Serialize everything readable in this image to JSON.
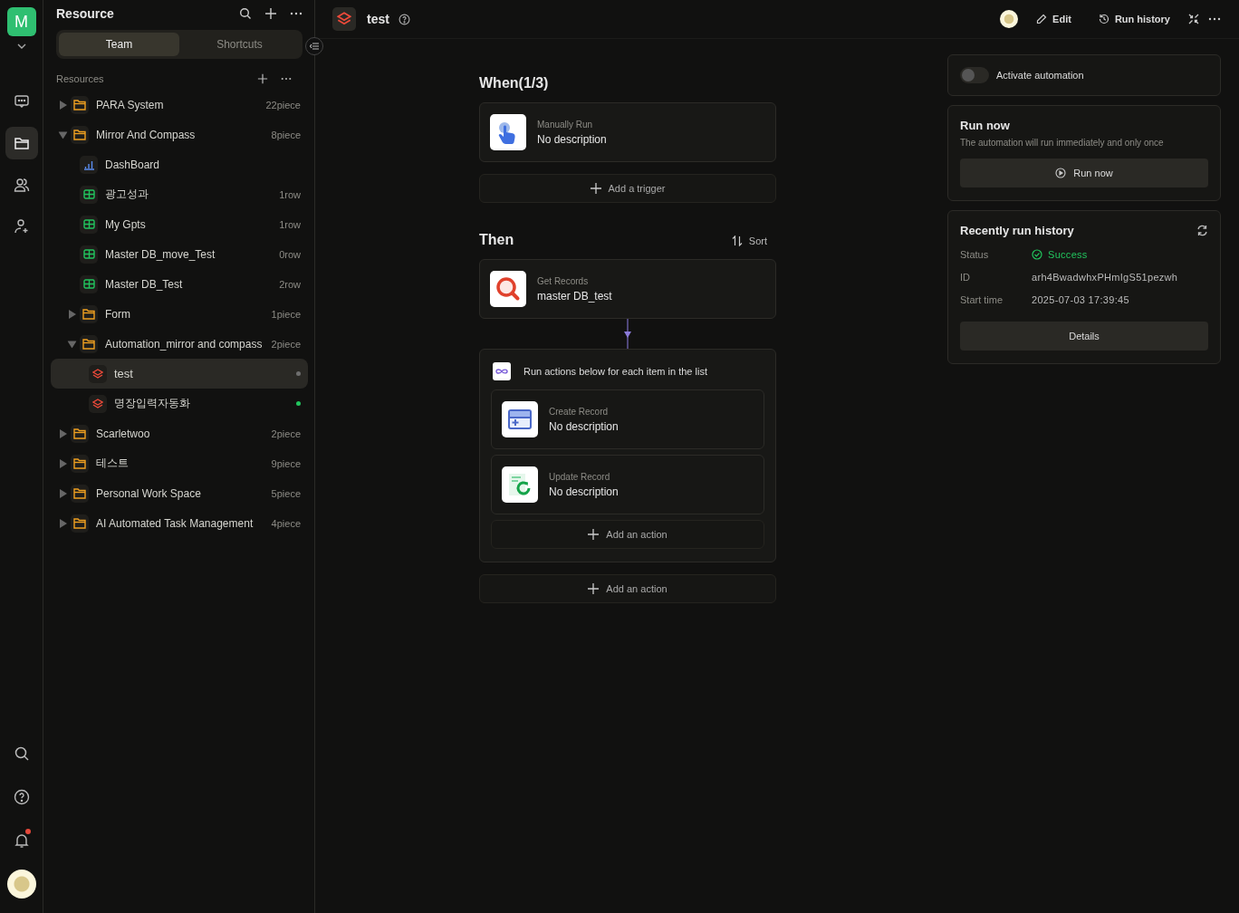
{
  "rail": {
    "workspace_initial": "M",
    "nav": [
      {
        "kind": "chat",
        "selected": false
      },
      {
        "kind": "folder",
        "selected": true
      },
      {
        "kind": "people",
        "selected": false
      },
      {
        "kind": "person-add",
        "selected": false
      }
    ],
    "bottom": [
      {
        "kind": "search",
        "badge": false
      },
      {
        "kind": "help",
        "badge": false
      },
      {
        "kind": "bell",
        "badge": true
      },
      {
        "kind": "avatar",
        "badge": false
      }
    ]
  },
  "sidebar": {
    "title": "Resource",
    "tabs": [
      {
        "label": "Team",
        "selected": true
      },
      {
        "label": "Shortcuts",
        "selected": false
      }
    ],
    "section_label": "Resources",
    "tree": [
      {
        "kind": "folder",
        "name": "PARA System",
        "count": "22piece",
        "expanded": false,
        "selected": false
      },
      {
        "kind": "folder",
        "name": "Mirror And Compass",
        "count": "8piece",
        "expanded": true,
        "selected": false,
        "children": [
          {
            "kind": "dashboard",
            "name": "DashBoard",
            "selected": false
          },
          {
            "kind": "table",
            "name": "광고성과",
            "count": "1row",
            "selected": false
          },
          {
            "kind": "table",
            "name": "My Gpts",
            "count": "1row",
            "selected": false
          },
          {
            "kind": "table",
            "name": "Master DB_move_Test",
            "count": "0row",
            "selected": false
          },
          {
            "kind": "table",
            "name": "Master DB_Test",
            "count": "2row",
            "selected": false
          },
          {
            "kind": "folder",
            "name": "Form",
            "count": "1piece",
            "expanded": false,
            "selected": false
          },
          {
            "kind": "folder",
            "name": "Automation_mirror and compass",
            "count": "2piece",
            "expanded": true,
            "selected": false,
            "children": [
              {
                "kind": "automation",
                "name": "test",
                "selected": true,
                "color": "#6e6e6e"
              },
              {
                "kind": "automation",
                "name": "명장입력자동화",
                "selected": false,
                "color": "#22c55e"
              }
            ]
          }
        ]
      },
      {
        "kind": "folder",
        "name": "Scarletwoo",
        "count": "2piece",
        "expanded": false,
        "selected": false
      },
      {
        "kind": "folder",
        "name": "테스트",
        "count": "9piece",
        "expanded": false,
        "selected": false
      },
      {
        "kind": "folder",
        "name": "Personal Work Space",
        "count": "5piece",
        "expanded": false,
        "selected": false
      },
      {
        "kind": "folder",
        "name": "AI Automated Task Management",
        "count": "4piece",
        "expanded": false,
        "selected": false
      }
    ]
  },
  "header": {
    "title": "test",
    "actions": [
      {
        "kind": "edit",
        "label": "Edit"
      },
      {
        "kind": "history",
        "label": "Run history"
      }
    ]
  },
  "canvas": {
    "when_heading": "When(1/3)",
    "triggers": [
      {
        "kind": "manual",
        "label": "Manually Run",
        "description": "No description"
      }
    ],
    "add_trigger": "Add a trigger",
    "then_heading": "Then",
    "sort": "Sort",
    "actions": [
      {
        "kind": "get-records",
        "label": "Get Records",
        "description": "master DB_test"
      },
      {
        "kind": "loop",
        "title": "Run actions below for each item in the list",
        "add_action": "Add an action",
        "children": [
          {
            "kind": "create-record",
            "label": "Create Record",
            "description": "No description"
          },
          {
            "kind": "update-record",
            "label": "Update Record",
            "description": "No description"
          }
        ]
      }
    ],
    "add_action": "Add an action"
  },
  "panel": {
    "activate": {
      "label": "Activate automation",
      "on": false
    },
    "run_now": {
      "title": "Run now",
      "subtitle": "The automation will run immediately and only once",
      "button": "Run now"
    },
    "history": {
      "title": "Recently run history",
      "rows": [
        {
          "kind": "status",
          "label": "Status",
          "value": "Success"
        },
        {
          "kind": "text",
          "label": "ID",
          "value": "arh4BwadwhxPHmIgS51pezwh"
        },
        {
          "kind": "text",
          "label": "Start time",
          "value": "2025-07-03 17:39:45"
        }
      ],
      "button": "Details"
    }
  }
}
